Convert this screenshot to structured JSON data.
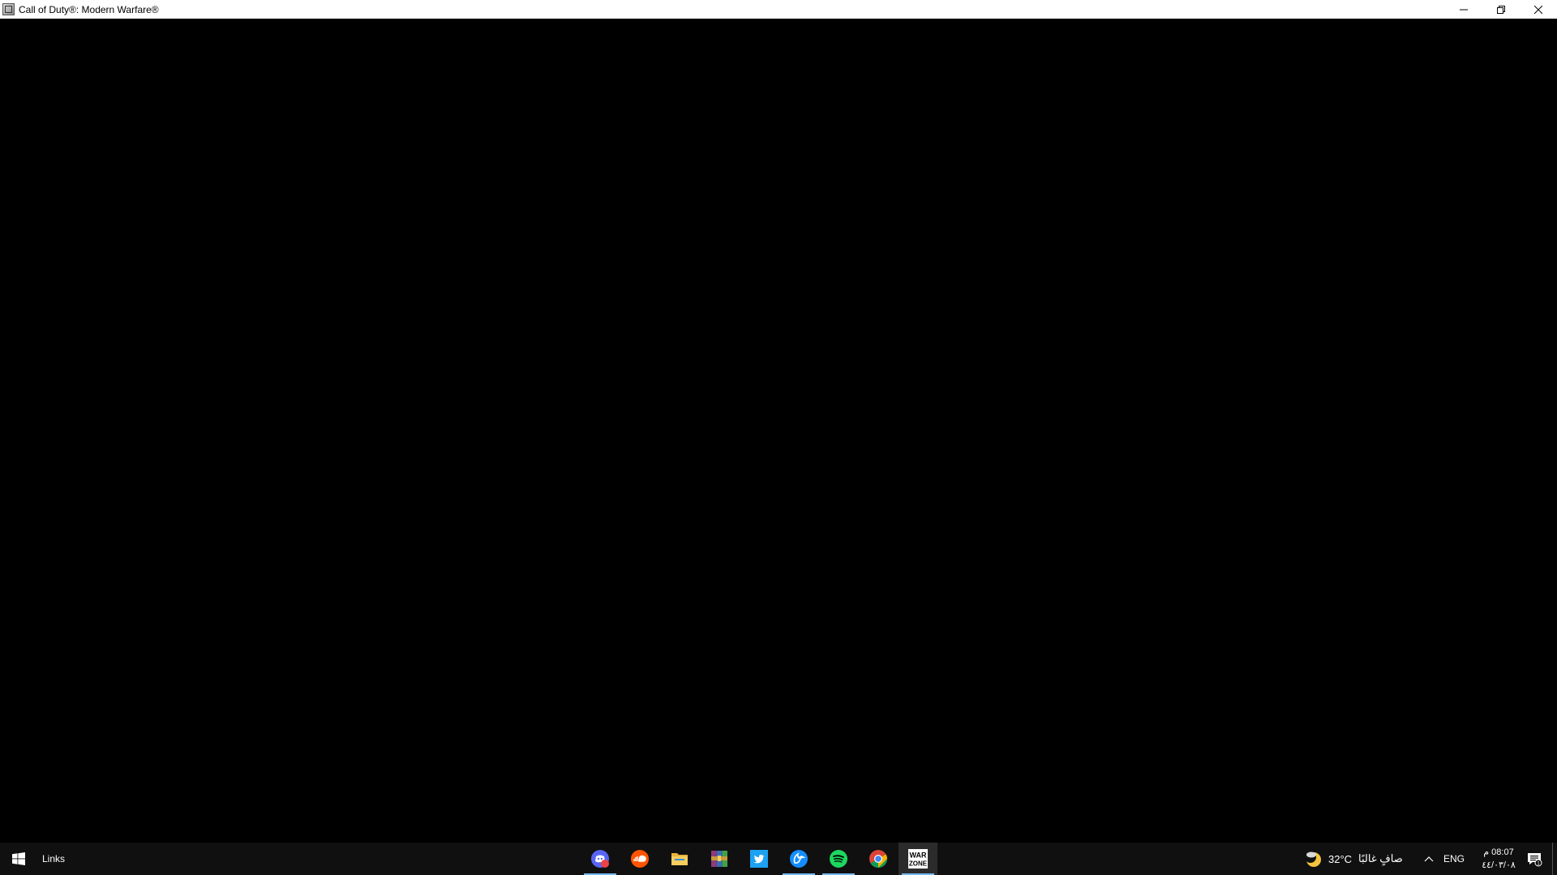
{
  "window": {
    "title": "Call of Duty®: Modern Warfare®",
    "icon": "game-window-icon"
  },
  "controls": {
    "minimize_icon": "minimize-icon",
    "restore_icon": "restore-icon",
    "close_icon": "close-icon"
  },
  "taskbar": {
    "start_icon": "windows-logo-icon",
    "links_label": "Links",
    "apps": [
      {
        "name": "Discord",
        "icon": "discord-icon",
        "badge": "9+",
        "running": true
      },
      {
        "name": "SoundCloud",
        "icon": "soundcloud-icon",
        "running": false
      },
      {
        "name": "File Explorer",
        "icon": "folder-icon",
        "running": false
      },
      {
        "name": "WinRAR",
        "icon": "winrar-icon",
        "running": false
      },
      {
        "name": "Twitter",
        "icon": "twitter-icon",
        "running": false
      },
      {
        "name": "Battle.net",
        "icon": "battlenet-icon",
        "running": true
      },
      {
        "name": "Spotify",
        "icon": "spotify-icon",
        "running": true
      },
      {
        "name": "Google Chrome",
        "icon": "chrome-icon",
        "running": false
      },
      {
        "name": "Warzone",
        "icon": "warzone-icon",
        "label": "WAR ZONE",
        "running": true,
        "active": true
      }
    ],
    "tray": {
      "weather_icon": "moon-cloud-icon",
      "temperature": "32°C",
      "condition": "صافٍ غالبًا",
      "language": "ENG",
      "time": "08:07 م",
      "date": "٤٤/٠٣/٠٨",
      "notification_count": "1"
    }
  },
  "colors": {
    "taskbar_bg": "#101010",
    "running_indicator": "#76b9ed",
    "content_bg": "#000000"
  }
}
